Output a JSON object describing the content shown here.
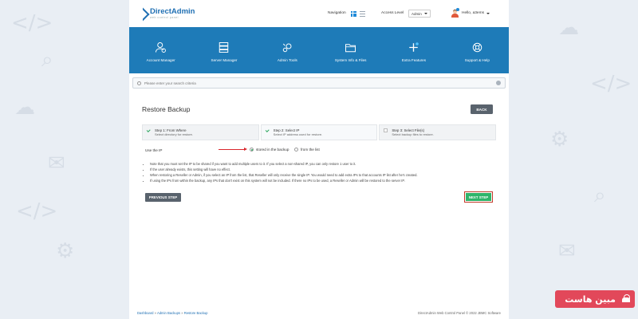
{
  "header": {
    "logo_title": "DirectAdmin",
    "logo_sub": "web control panel",
    "navigation_label": "Navigation",
    "access_level_label": "Access Level",
    "access_level_value": "Admin",
    "user_greeting": "Hello, a3ems"
  },
  "menu": [
    {
      "label": "Account Manager",
      "icon": "account-manager-icon"
    },
    {
      "label": "Server Manager",
      "icon": "server-manager-icon"
    },
    {
      "label": "Admin Tools",
      "icon": "admin-tools-icon"
    },
    {
      "label": "System Info & Files",
      "icon": "folder-icon"
    },
    {
      "label": "Extra Features",
      "icon": "plus-icon"
    },
    {
      "label": "Support & Help",
      "icon": "lifebuoy-icon"
    }
  ],
  "search": {
    "placeholder": "Please enter your search criteria"
  },
  "page": {
    "title": "Restore Backup",
    "back_label": "BACK"
  },
  "steps": [
    {
      "title": "Step 1: From Where",
      "desc": "Select directory for restore."
    },
    {
      "title": "Step 2: Select IP",
      "desc": "Select IP address used for restore."
    },
    {
      "title": "Step 3: Select File(s)",
      "desc": "Select backup files to restore."
    }
  ],
  "ip": {
    "label": "Use the IP",
    "option_stored": "stored in the backup",
    "option_list": "from the list"
  },
  "notes": [
    "Note that you must set the IP to be shared if you want to add multiple users to it. If you select a non-shared IP, you can only restore 1 user to it.",
    "If the user already exists, this setting will have no effect.",
    "When restoring a Reseller or Admin, if you select an IP from the list, that Reseller will only receive the single IP. You would need to add extra IPs to that accounts IP list after he's created.",
    "If using the IPs from within the backup, any IPs that don't exist on this system will not be included. If there no IPs to be used, a Reseller or Admin will be restored to the server IP."
  ],
  "actions": {
    "previous_label": "PREVIOUS STEP",
    "next_label": "NEXT STEP"
  },
  "footer": {
    "crumb_1": "Dashboard",
    "crumb_2": "Admin Backups",
    "crumb_3": "Restore Backup",
    "copyright": "DirectAdmin Web Control Panel © 2022 JBMC Software"
  },
  "watermark": {
    "text": "مبین هاست"
  },
  "colors": {
    "brand_blue": "#1e7bb8",
    "next_green": "#2fb46a",
    "back_gray": "#59636d",
    "arrow_red": "#d9262c"
  }
}
